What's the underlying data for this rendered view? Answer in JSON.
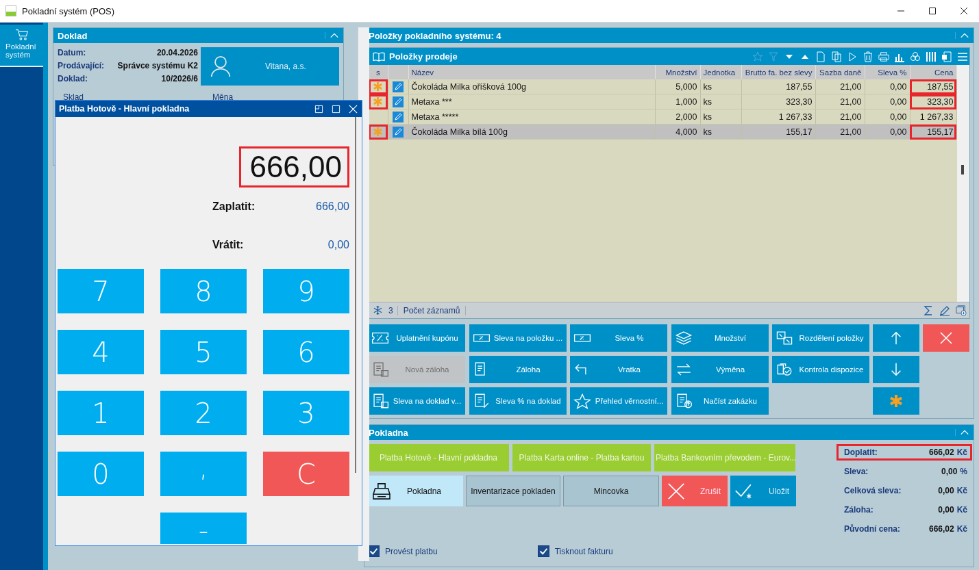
{
  "window": {
    "title": "Pokladní systém (POS)"
  },
  "sidebar": {
    "items": [
      {
        "label": "Pokladní systém",
        "selected": true
      }
    ]
  },
  "doklad": {
    "title": "Doklad",
    "fields": [
      {
        "label": "Datum:",
        "value": "20.04.2026"
      },
      {
        "label": "Prodávající:",
        "value": "Správce systému K2"
      },
      {
        "label": "Doklad:",
        "value": "10/2026/6"
      }
    ],
    "customer": "Vitana, a.s.",
    "sub_labels": [
      "Sklad",
      "Měna"
    ]
  },
  "dialog": {
    "title": "Platba Hotově - Hlavní pokladna",
    "display": "666,00",
    "display_highlighted": true,
    "totals": [
      {
        "label": "Zaplatit:",
        "value": "666,00"
      },
      {
        "label": "Vrátit:",
        "value": "0,00"
      }
    ],
    "keys": [
      {
        "label": "7",
        "kind": "digit"
      },
      {
        "label": "8",
        "kind": "digit"
      },
      {
        "label": "9",
        "kind": "digit"
      },
      {
        "label": "4",
        "kind": "digit"
      },
      {
        "label": "5",
        "kind": "digit"
      },
      {
        "label": "6",
        "kind": "digit"
      },
      {
        "label": "1",
        "kind": "digit"
      },
      {
        "label": "2",
        "kind": "digit"
      },
      {
        "label": "3",
        "kind": "digit"
      },
      {
        "label": "0",
        "kind": "digit"
      },
      {
        "label": ",",
        "kind": "comma"
      },
      {
        "label": "C",
        "kind": "clear"
      },
      {
        "label": "-",
        "kind": "minus"
      }
    ]
  },
  "items_panel": {
    "title": "Položky pokladního systému: 4",
    "grid_title": "Položky prodeje",
    "columns": [
      "s",
      "",
      "Název",
      "Množství",
      "Jednotka",
      "Brutto fa. bez slevy",
      "Sazba daně",
      "Sleva %",
      "Cena"
    ],
    "rows": [
      {
        "star": true,
        "highlighted": true,
        "selected": false,
        "cells": [
          "",
          "",
          "Čokoláda Milka oříšková 100g",
          "5,000",
          "ks",
          "187,55",
          "21,00",
          "0,00",
          "187,55"
        ]
      },
      {
        "star": true,
        "highlighted": true,
        "selected": false,
        "cells": [
          "",
          "",
          "Metaxa ***",
          "1,000",
          "ks",
          "323,30",
          "21,00",
          "0,00",
          "323,30"
        ]
      },
      {
        "star": false,
        "highlighted": false,
        "selected": false,
        "cells": [
          "",
          "",
          "Metaxa *****",
          "2,000",
          "ks",
          "1 267,33",
          "21,00",
          "0,00",
          "1 267,33"
        ]
      },
      {
        "star": true,
        "highlighted": true,
        "selected": true,
        "cells": [
          "",
          "",
          "Čokoláda Milka bílá 100g",
          "4,000",
          "ks",
          "155,17",
          "21,00",
          "0,00",
          "155,17"
        ]
      }
    ],
    "footer": {
      "count": "3",
      "label": "Počet záznamů"
    },
    "actions": [
      {
        "label": "Uplatnění kupónu",
        "kind": "coupon",
        "disabled": false
      },
      {
        "label": "Sleva na položku ...",
        "kind": "item-discount",
        "disabled": false
      },
      {
        "label": "Sleva %",
        "kind": "percent",
        "disabled": false
      },
      {
        "label": "Množství",
        "kind": "layers",
        "disabled": false
      },
      {
        "label": "Rozdělení položky",
        "kind": "split",
        "disabled": false
      },
      {
        "label": "Nová záloha",
        "kind": "new-advance",
        "disabled": true
      },
      {
        "label": "Záloha",
        "kind": "advance",
        "disabled": false
      },
      {
        "label": "Vratka",
        "kind": "return",
        "disabled": false
      },
      {
        "label": "Výměna",
        "kind": "exchange",
        "disabled": false
      },
      {
        "label": "Kontrola dispozice",
        "kind": "check",
        "disabled": false
      },
      {
        "label": "Sleva na doklad v...",
        "kind": "doc-discount",
        "disabled": false
      },
      {
        "label": "Sleva % na doklad",
        "kind": "doc-percent",
        "disabled": false
      },
      {
        "label": "Přehled věrnostní...",
        "kind": "loyalty",
        "disabled": false
      },
      {
        "label": "Načíst zakázku",
        "kind": "load",
        "disabled": false
      }
    ]
  },
  "pokladna": {
    "title": "Pokladna",
    "payments": [
      "Platba Hotově - Hlavní pokladna",
      "Platba Karta online - Platba kartou",
      "Platba Bankovním převodem - Eurov..."
    ],
    "modes": [
      {
        "label": "Pokladna",
        "selected": true,
        "kind": "register"
      },
      {
        "label": "Inventarizace pokladen",
        "selected": false,
        "kind": "plain"
      },
      {
        "label": "Mincovka",
        "selected": false,
        "kind": "plain"
      }
    ],
    "commands": [
      {
        "label": "Zrušit",
        "kind": "cancel"
      },
      {
        "label": "Uložit",
        "kind": "save"
      }
    ],
    "summary": [
      {
        "label": "Doplatit:",
        "value": "666,02",
        "unit": "Kč",
        "highlighted": true
      },
      {
        "label": "Sleva:",
        "value": "0,00",
        "unit": "%",
        "highlighted": false
      },
      {
        "label": "Celková sleva:",
        "value": "0,00",
        "unit": "Kč",
        "highlighted": false
      },
      {
        "label": "Záloha:",
        "value": "0,00",
        "unit": "Kč",
        "highlighted": false
      },
      {
        "label": "Původní cena:",
        "value": "666,02",
        "unit": "Kč",
        "highlighted": false
      }
    ],
    "checkboxes": [
      {
        "label": "Provést platbu",
        "checked": true
      },
      {
        "label": "Tisknout fakturu",
        "checked": true
      }
    ]
  }
}
